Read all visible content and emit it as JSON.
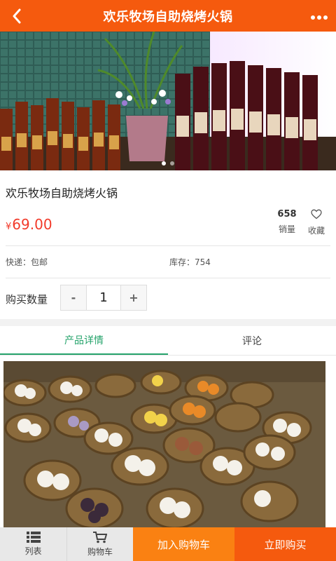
{
  "header": {
    "title": "欢乐牧场自助烧烤火锅",
    "back_icon": "chevron-left-icon",
    "more_icon": "more-dots-icon"
  },
  "colors": {
    "header_bg": "#f55a0e",
    "price": "#f23a2a",
    "tab_active": "#25a36b",
    "add_cart_bg": "#fa8112",
    "buy_now_bg": "#f55a0e"
  },
  "product": {
    "title": "欢乐牧场自助烧烤火锅",
    "price_symbol": "¥",
    "price_value": "69.00",
    "sales_count": "658",
    "sales_label": "销量",
    "favorite_label": "收藏",
    "shipping_label": "快递：包邮",
    "stock_label": "库存：754"
  },
  "carousel": {
    "slide_count": 2,
    "active_index": 0
  },
  "quantity": {
    "label": "购买数量",
    "minus": "-",
    "value": "1",
    "plus": "+"
  },
  "tabs": [
    {
      "label": "产品详情",
      "active": true
    },
    {
      "label": "评论",
      "active": false
    }
  ],
  "bottom_bar": {
    "list_label": "列表",
    "cart_label": "购物车",
    "add_to_cart": "加入购物车",
    "buy_now": "立即购买"
  }
}
